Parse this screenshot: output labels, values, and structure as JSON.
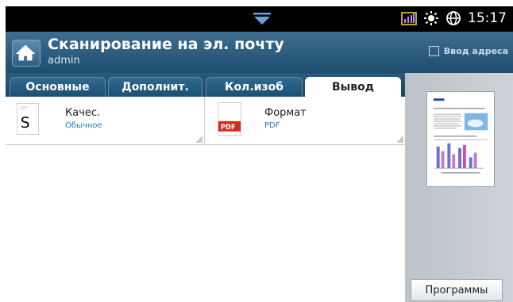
{
  "status_bar": {
    "time": "15:17",
    "icons": [
      "signal-bars-icon",
      "brightness-icon",
      "globe-icon"
    ]
  },
  "header": {
    "title": "Сканирование на эл. почту",
    "user": "admin",
    "address_button": "Ввод адреса"
  },
  "tabs": [
    {
      "label": "Основные",
      "active": false
    },
    {
      "label": "Дополнит.",
      "active": false
    },
    {
      "label": "Кол.изоб",
      "active": false
    },
    {
      "label": "Вывод",
      "active": true
    }
  ],
  "settings": [
    {
      "label": "Качес.",
      "value": "Обычное",
      "icon": "quality-icon",
      "icon_letter": "S"
    },
    {
      "label": "Формат",
      "value": "PDF",
      "icon": "pdf-file-icon",
      "icon_badge": "PDF"
    }
  ],
  "sidebar": {
    "programs_button": "Программы"
  },
  "colors": {
    "header_bg": "#2b5a7e",
    "tab_active": "#ffffff",
    "value_text": "#2a79c6",
    "pdf_badge": "#d62b1f",
    "side_panel": "#c4cbd1"
  }
}
